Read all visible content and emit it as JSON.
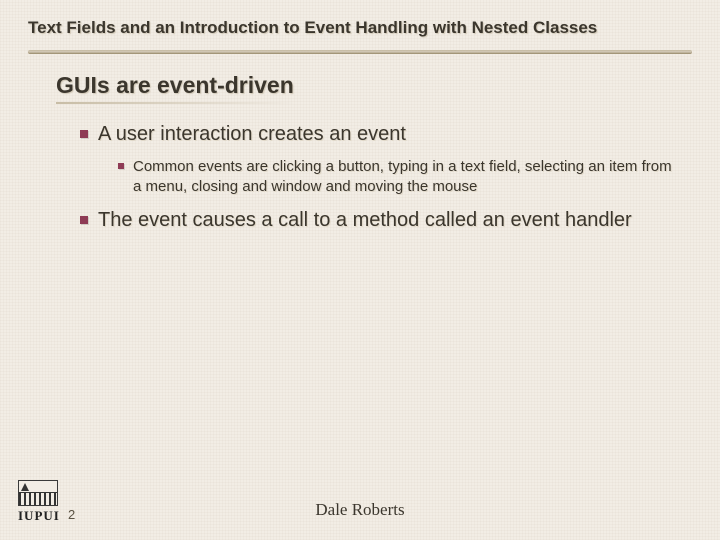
{
  "title": "Text Fields and an Introduction to Event Handling with Nested Classes",
  "heading": "GUIs are event-driven",
  "bullets": {
    "b1": "A user interaction creates an event",
    "b1_sub": "Common events are clicking a button, typing in a text field, selecting an item from a menu, closing and window and moving the mouse",
    "b2": "The event causes a call to a method called an event handler"
  },
  "footer": {
    "page": "2",
    "author": "Dale Roberts",
    "logo_text": "IUPUI"
  }
}
